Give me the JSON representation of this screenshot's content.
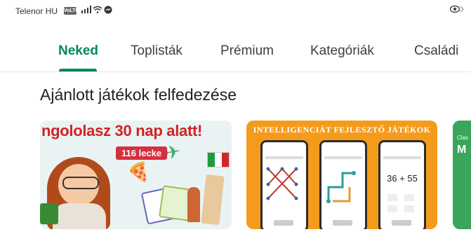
{
  "status_bar": {
    "carrier": "Telenor HU",
    "vo_badge": "VoLTE",
    "signal_icon": "signal-icon",
    "wifi_icon": "wifi-icon",
    "messenger_icon": "messenger-icon",
    "eye_icon": "eye-icon"
  },
  "tabs": [
    {
      "label": "Neked",
      "active": true
    },
    {
      "label": "Toplisták",
      "active": false
    },
    {
      "label": "Prémium",
      "active": false
    },
    {
      "label": "Kategóriák",
      "active": false
    },
    {
      "label": "Családi",
      "active": false
    }
  ],
  "colors": {
    "accent": "#01875f",
    "card1_bg": "#e9f3f4",
    "card2_bg": "#f59b1c",
    "card3_bg": "#3aa65b"
  },
  "section": {
    "title": "Ajánlott játékok felfedezése"
  },
  "cards": [
    {
      "headline": "ngololasz 30 nap alatt!",
      "badge": "116 lecke"
    },
    {
      "headline": "INTELLIGENCIÁT FEJLESZTŐ JÁTÉKOK",
      "equation": "36 + 55"
    },
    {
      "small": "Clas",
      "big": "M"
    }
  ]
}
